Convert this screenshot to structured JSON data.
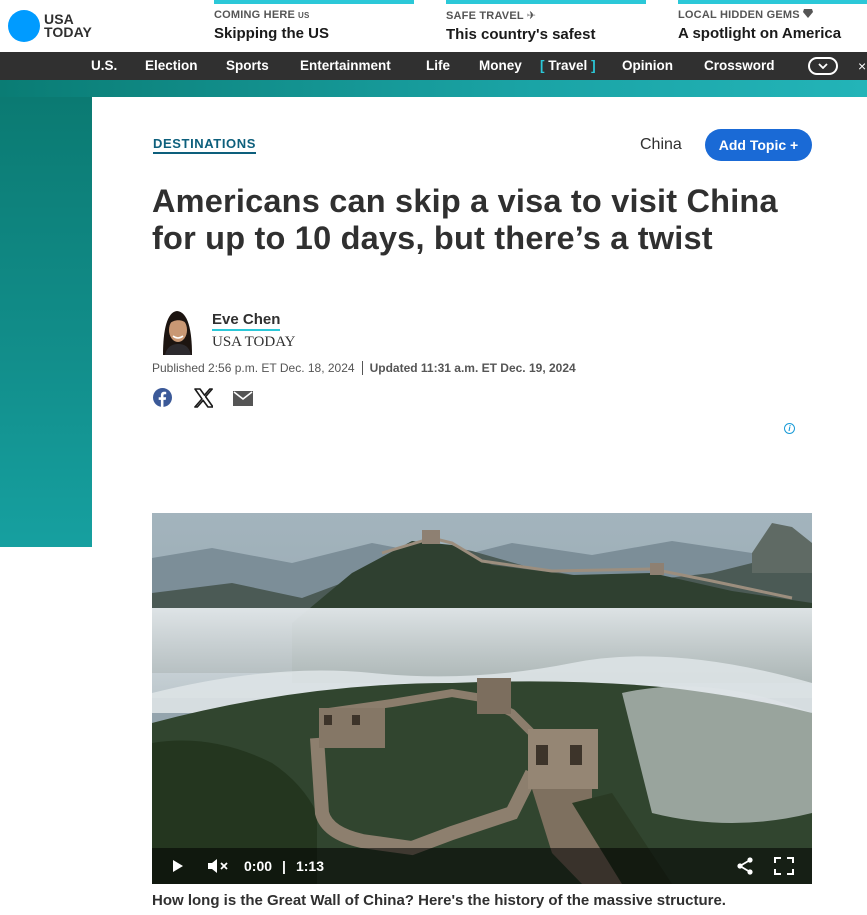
{
  "brand": {
    "line1": "USA",
    "line2": "TODAY"
  },
  "promos": [
    {
      "kicker": "COMING HERE",
      "kicker_suffix": "US",
      "title": "Skipping the US"
    },
    {
      "kicker": "SAFE TRAVEL",
      "kicker_icon": "airplane-icon",
      "title": "This country's safest"
    },
    {
      "kicker": "LOCAL HIDDEN GEMS",
      "kicker_icon": "gem-icon",
      "title": "A spotlight on America"
    }
  ],
  "nav": {
    "items": [
      "U.S.",
      "Election",
      "Sports",
      "Entertainment",
      "Life",
      "Money",
      "Travel",
      "Opinion",
      "Crossword"
    ],
    "active": "Travel",
    "bracket_open": "[",
    "bracket_close": "]"
  },
  "article": {
    "section": "DESTINATIONS",
    "topic": "China",
    "add_topic": "Add Topic +",
    "headline": "Americans can skip a visa to visit China for up to 10 days, but there’s a twist",
    "author": {
      "name": "Eve Chen",
      "org": "USA TODAY"
    },
    "published": "Published 2:56 p.m. ET Dec. 18, 2024",
    "updated": "Updated 11:31 a.m. ET Dec. 19, 2024",
    "share_icons": [
      "facebook-icon",
      "x-icon",
      "mail-icon"
    ],
    "ad_info": "i"
  },
  "video": {
    "current_time": "0:00",
    "separator": "|",
    "duration": "1:13",
    "caption": "How long is the Great Wall of China? Here's the history of the massive structure."
  },
  "colors": {
    "accent": "#2bc8d8",
    "brand_blue": "#009bff",
    "button_blue": "#1a6ad6",
    "nav_bg": "#303030",
    "teal": "#0b7a72"
  }
}
